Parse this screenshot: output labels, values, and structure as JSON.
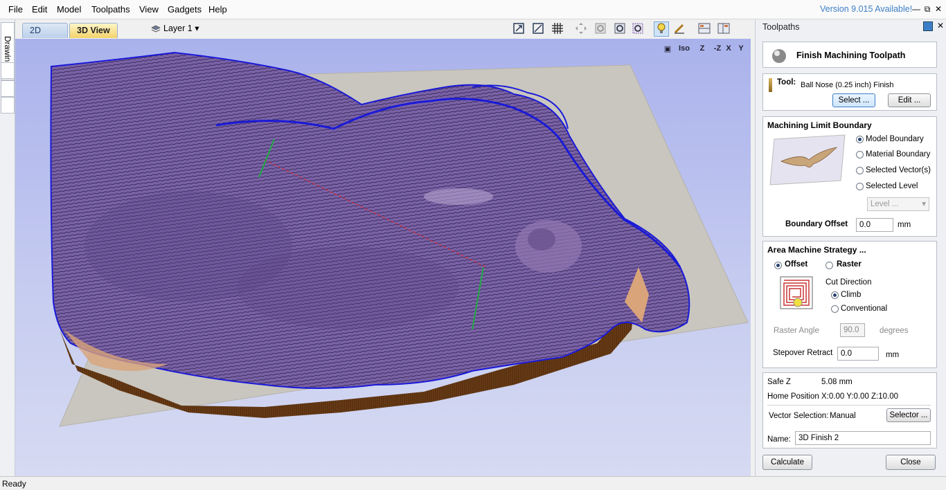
{
  "menu": [
    "File",
    "Edit",
    "Model",
    "Toolpaths",
    "View",
    "Gadgets",
    "Help"
  ],
  "version_notice": "Version 9.015 Available!",
  "window_controls": {
    "minimize": "—",
    "restore": "⧉",
    "close": "✕"
  },
  "left_tab": "Drawing",
  "view_tabs": {
    "tab_2d": "2D View",
    "tab_3d": "3D View"
  },
  "layer": {
    "label": "Layer 1",
    "arrow": "▾"
  },
  "toolbar_icons": [
    "zoom-extents-icon",
    "zoom-box-icon",
    "grid-icon",
    "pan-icon",
    "zoom-icon",
    "rotate-icon",
    "render-icon",
    "light-icon",
    "tool-icon",
    "split-view-icon",
    "panel-icon"
  ],
  "axis_views": [
    "▣",
    "Iso",
    "Z",
    "-Z",
    "X",
    "Y"
  ],
  "panel": {
    "title": "Toolpaths",
    "heading": "Finish Machining Toolpath",
    "tool": {
      "label": "Tool:",
      "value": "Ball Nose (0.25 inch) Finish",
      "select": "Select ...",
      "edit": "Edit ..."
    },
    "boundary": {
      "title": "Machining Limit Boundary",
      "options": [
        "Model Boundary",
        "Material Boundary",
        "Selected Vector(s)",
        "Selected Level"
      ],
      "level_placeholder": "Level ...",
      "offset_label": "Boundary Offset",
      "offset_value": "0.0",
      "offset_unit": "mm"
    },
    "strategy": {
      "title": "Area Machine Strategy ...",
      "offset": "Offset",
      "raster": "Raster",
      "cut_direction": "Cut Direction",
      "climb": "Climb",
      "conventional": "Conventional",
      "raster_angle_label": "Raster Angle",
      "raster_angle_value": "90.0",
      "raster_angle_unit": "degrees",
      "stepover_label": "Stepover Retract",
      "stepover_value": "0.0",
      "stepover_unit": "mm"
    },
    "info": {
      "safe_z_label": "Safe Z",
      "safe_z_value": "5.08 mm",
      "home_label": "Home Position",
      "home_value": "X:0.00 Y:0.00 Z:10.00",
      "vector_sel_label": "Vector Selection:",
      "vector_sel_value": "Manual",
      "selector": "Selector ...",
      "name_label": "Name:",
      "name_value": "3D Finish 2"
    },
    "calculate": "Calculate",
    "close": "Close"
  },
  "status": "Ready",
  "colors": {
    "accent": "#3c7fc6",
    "toolpath": "#1a1ad8",
    "model": "#7a5fa0",
    "wall": "#5a3414"
  }
}
